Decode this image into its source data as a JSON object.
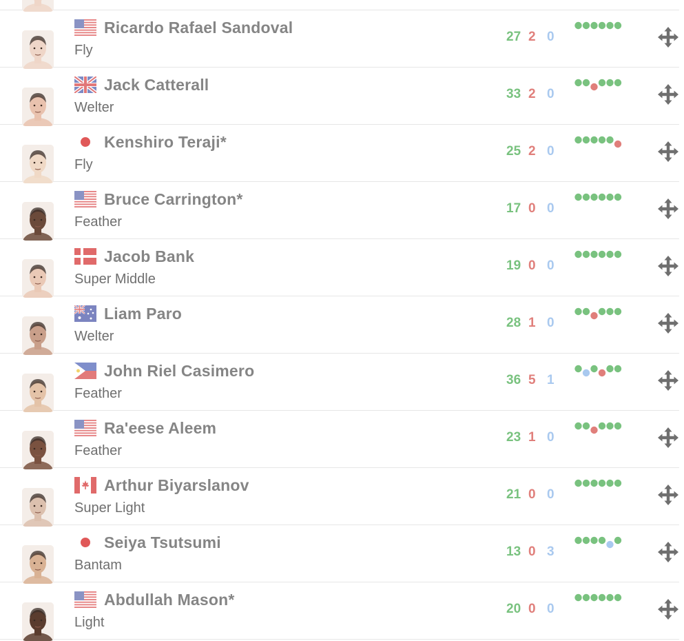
{
  "colors": {
    "win": "#79c27f",
    "loss": "#e07f7b",
    "draw": "#a9c9ef",
    "name": "#858585",
    "division": "#6f6f6f",
    "divider": "#e6e6e6",
    "move_icon": "#6f6f6f"
  },
  "boxers": [
    {
      "name": "",
      "division": "",
      "flag": "none",
      "avatar_tone": "#efd6c8",
      "record": {
        "wins": "",
        "losses": "",
        "draws": ""
      },
      "form": []
    },
    {
      "name": "Ricardo Rafael Sandoval",
      "division": "Fly",
      "flag": "us-flag",
      "avatar_tone": "#efd6c8",
      "record": {
        "wins": "27",
        "losses": "2",
        "draws": "0"
      },
      "form": [
        "W",
        "W",
        "W",
        "W",
        "W",
        "W"
      ]
    },
    {
      "name": "Jack Catterall",
      "division": "Welter",
      "flag": "uk-flag",
      "avatar_tone": "#e9c2ae",
      "record": {
        "wins": "33",
        "losses": "2",
        "draws": "0"
      },
      "form": [
        "W",
        "W",
        "L",
        "W",
        "W",
        "W"
      ]
    },
    {
      "name": "Kenshiro Teraji*",
      "division": "Fly",
      "flag": "japan-flag",
      "avatar_tone": "#f0d9c6",
      "record": {
        "wins": "25",
        "losses": "2",
        "draws": "0"
      },
      "form": [
        "W",
        "W",
        "W",
        "W",
        "W",
        "L"
      ]
    },
    {
      "name": "Bruce Carrington*",
      "division": "Feather",
      "flag": "us-flag",
      "avatar_tone": "#6b4a3a",
      "record": {
        "wins": "17",
        "losses": "0",
        "draws": "0"
      },
      "form": [
        "W",
        "W",
        "W",
        "W",
        "W",
        "W"
      ]
    },
    {
      "name": "Jacob Bank",
      "division": "Super Middle",
      "flag": "denmark-flag",
      "avatar_tone": "#eac9b6",
      "record": {
        "wins": "19",
        "losses": "0",
        "draws": "0"
      },
      "form": [
        "W",
        "W",
        "W",
        "W",
        "W",
        "W"
      ]
    },
    {
      "name": "Liam Paro",
      "division": "Welter",
      "flag": "australia-flag",
      "avatar_tone": "#c99f8a",
      "record": {
        "wins": "28",
        "losses": "1",
        "draws": "0"
      },
      "form": [
        "W",
        "W",
        "L",
        "W",
        "W",
        "W"
      ]
    },
    {
      "name": "John Riel Casimero",
      "division": "Feather",
      "flag": "philippines-flag",
      "avatar_tone": "#e4c3a8",
      "record": {
        "wins": "36",
        "losses": "5",
        "draws": "1"
      },
      "form": [
        "W",
        "D",
        "W",
        "L",
        "W",
        "W"
      ]
    },
    {
      "name": "Ra'eese Aleem",
      "division": "Feather",
      "flag": "us-flag",
      "avatar_tone": "#7a5240",
      "record": {
        "wins": "23",
        "losses": "1",
        "draws": "0"
      },
      "form": [
        "W",
        "W",
        "L",
        "W",
        "W",
        "W"
      ]
    },
    {
      "name": "Arthur Biyarslanov",
      "division": "Super Light",
      "flag": "canada-flag",
      "avatar_tone": "#dcc0ae",
      "record": {
        "wins": "21",
        "losses": "0",
        "draws": "0"
      },
      "form": [
        "W",
        "W",
        "W",
        "W",
        "W",
        "W"
      ]
    },
    {
      "name": "Seiya Tsutsumi",
      "division": "Bantam",
      "flag": "japan-flag",
      "avatar_tone": "#d9b294",
      "record": {
        "wins": "13",
        "losses": "0",
        "draws": "3"
      },
      "form": [
        "W",
        "W",
        "W",
        "W",
        "D",
        "W"
      ]
    },
    {
      "name": "Abdullah Mason*",
      "division": "Light",
      "flag": "us-flag",
      "avatar_tone": "#5a3c2e",
      "record": {
        "wins": "20",
        "losses": "0",
        "draws": "0"
      },
      "form": [
        "W",
        "W",
        "W",
        "W",
        "W",
        "W"
      ]
    }
  ]
}
